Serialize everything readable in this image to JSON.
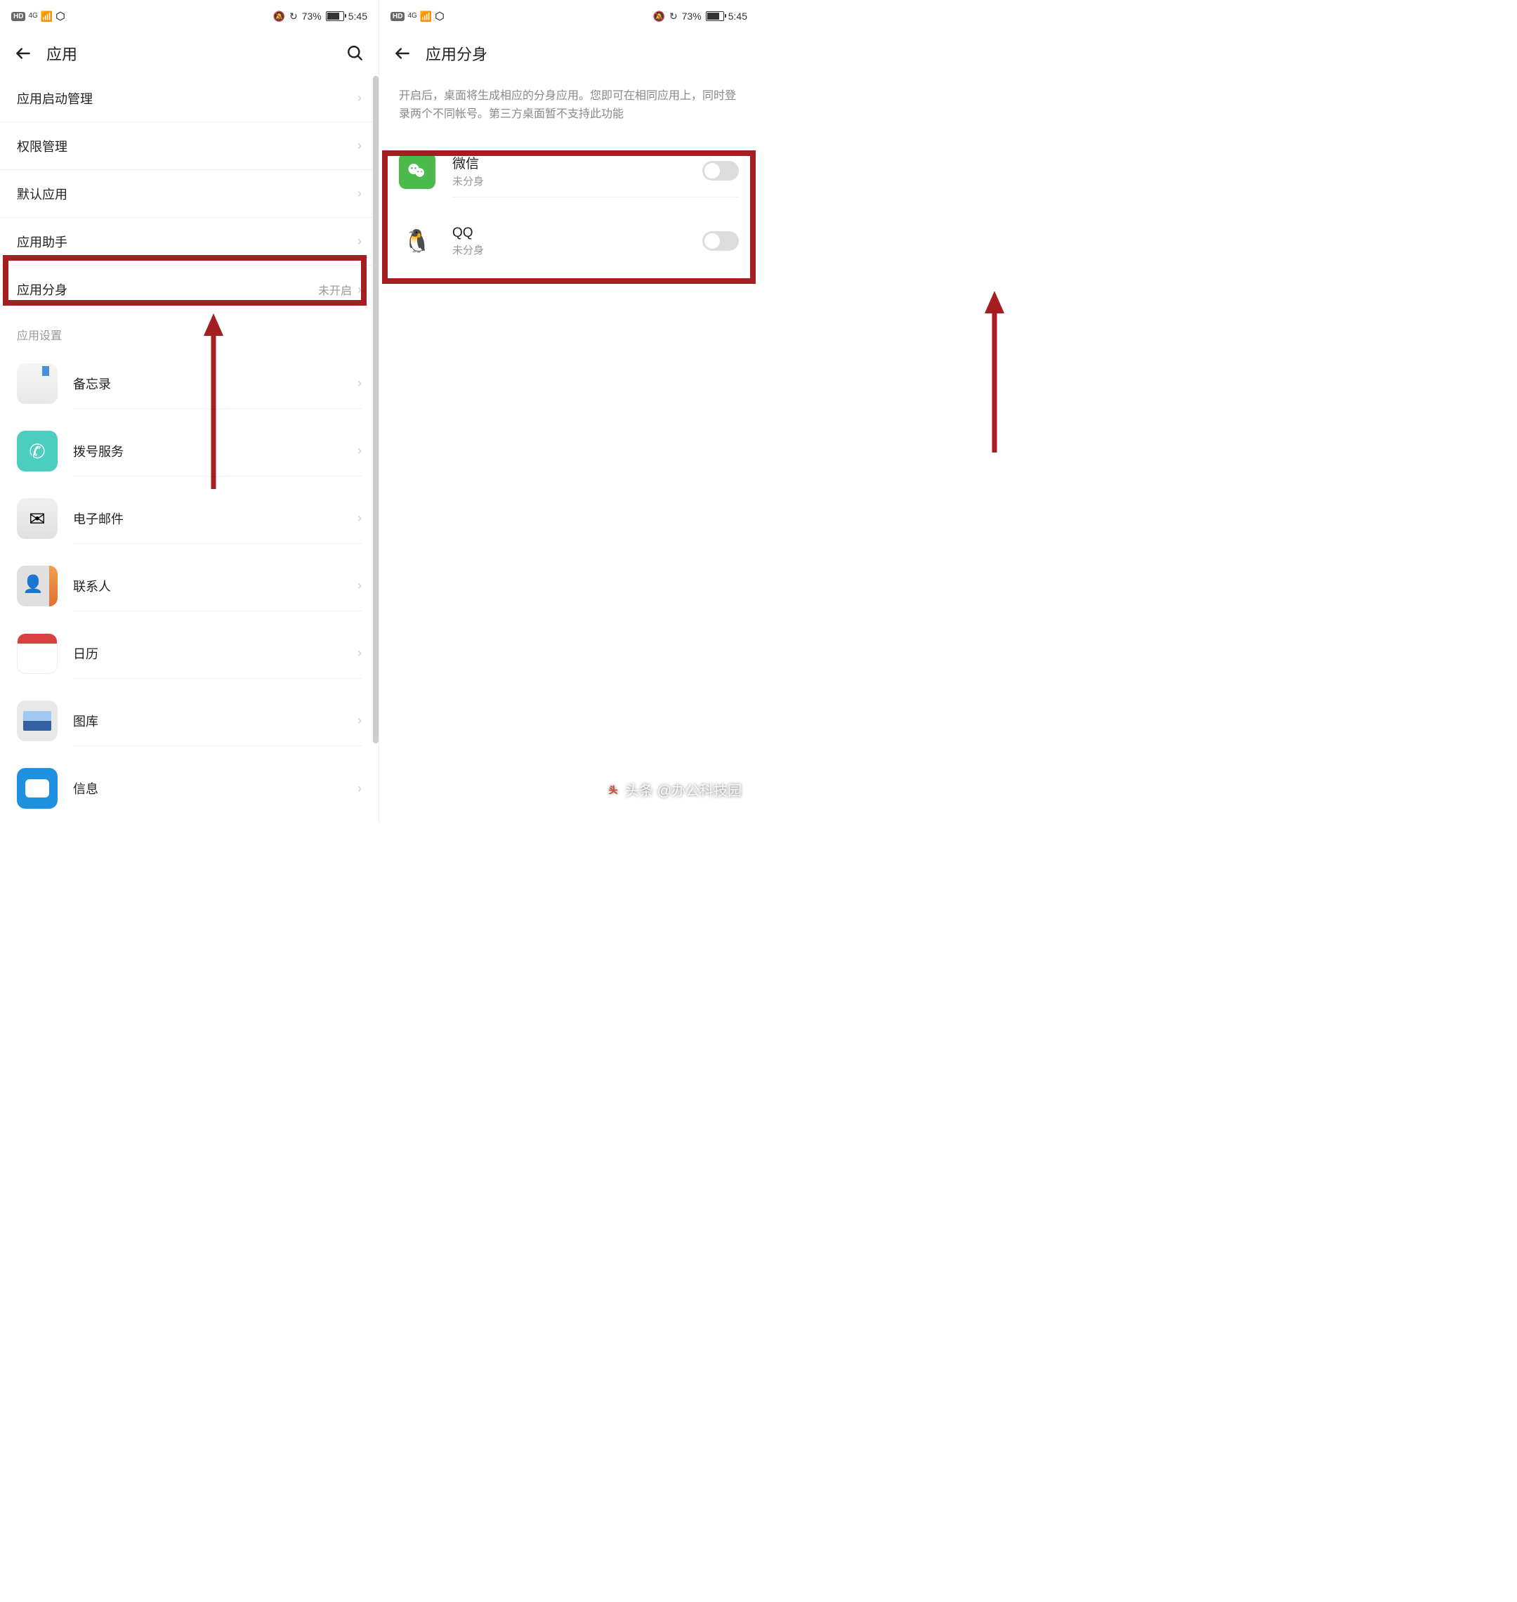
{
  "status": {
    "battery_pct": "73%",
    "time": "5:45",
    "signal": "4G"
  },
  "left": {
    "title": "应用",
    "items": [
      {
        "label": "应用启动管理"
      },
      {
        "label": "权限管理"
      },
      {
        "label": "默认应用"
      },
      {
        "label": "应用助手"
      },
      {
        "label": "应用分身",
        "value": "未开启"
      }
    ],
    "section_header": "应用设置",
    "apps": [
      {
        "name": "备忘录"
      },
      {
        "name": "拨号服务"
      },
      {
        "name": "电子邮件"
      },
      {
        "name": "联系人"
      },
      {
        "name": "日历"
      },
      {
        "name": "图库"
      },
      {
        "name": "信息"
      }
    ]
  },
  "right": {
    "title": "应用分身",
    "description": "开启后，桌面将生成相应的分身应用。您即可在相同应用上，同时登录两个不同帐号。第三方桌面暂不支持此功能",
    "apps": [
      {
        "name": "微信",
        "status": "未分身"
      },
      {
        "name": "QQ",
        "status": "未分身"
      }
    ]
  },
  "watermark": "头条 @办公科技园"
}
